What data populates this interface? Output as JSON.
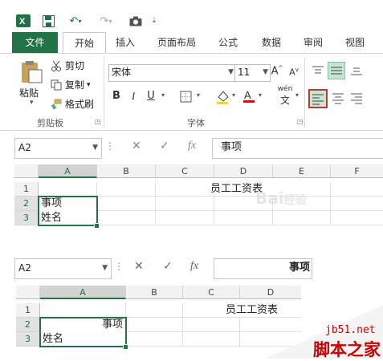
{
  "colors": {
    "accent": "#217346",
    "badge": "#cc0000"
  },
  "quick_access": {
    "icons": [
      "excel-icon",
      "save-icon",
      "undo-icon",
      "redo-icon",
      "camera-icon"
    ]
  },
  "tabs": [
    "文件",
    "开始",
    "插入",
    "页面布局",
    "公式",
    "数据",
    "审阅",
    "视图"
  ],
  "clipboard": {
    "paste": "粘贴",
    "cut": "剪切",
    "copy": "复制",
    "format_painter": "格式刷",
    "group": "剪贴板"
  },
  "font": {
    "name": "宋体",
    "size": "11",
    "group": "字体",
    "grow": "A",
    "shrink": "A",
    "bold": "B",
    "italic": "I",
    "underline": "U",
    "wen": "wén",
    "wen2": "文"
  },
  "top_bar": {
    "name_box": "A2",
    "formula": "事项"
  },
  "sheet1": {
    "columns": [
      "A",
      "B",
      "C",
      "D",
      "E",
      "F"
    ],
    "rows": [
      "1",
      "2",
      "3"
    ],
    "title": "员工工资表",
    "a2": "事项",
    "a3": "姓名"
  },
  "bottom_bar": {
    "name_box": "A2",
    "formula": "事项"
  },
  "sheet2": {
    "columns": [
      "A",
      "B",
      "C",
      "D"
    ],
    "rows": [
      "1",
      "2",
      "3"
    ],
    "title": "员工工资表",
    "a2": "事项",
    "a3": "姓名"
  },
  "watermark": {
    "site": "jb51.net",
    "brand": "脚本之家",
    "baidu": "Bai",
    "baidu2": "经验"
  }
}
